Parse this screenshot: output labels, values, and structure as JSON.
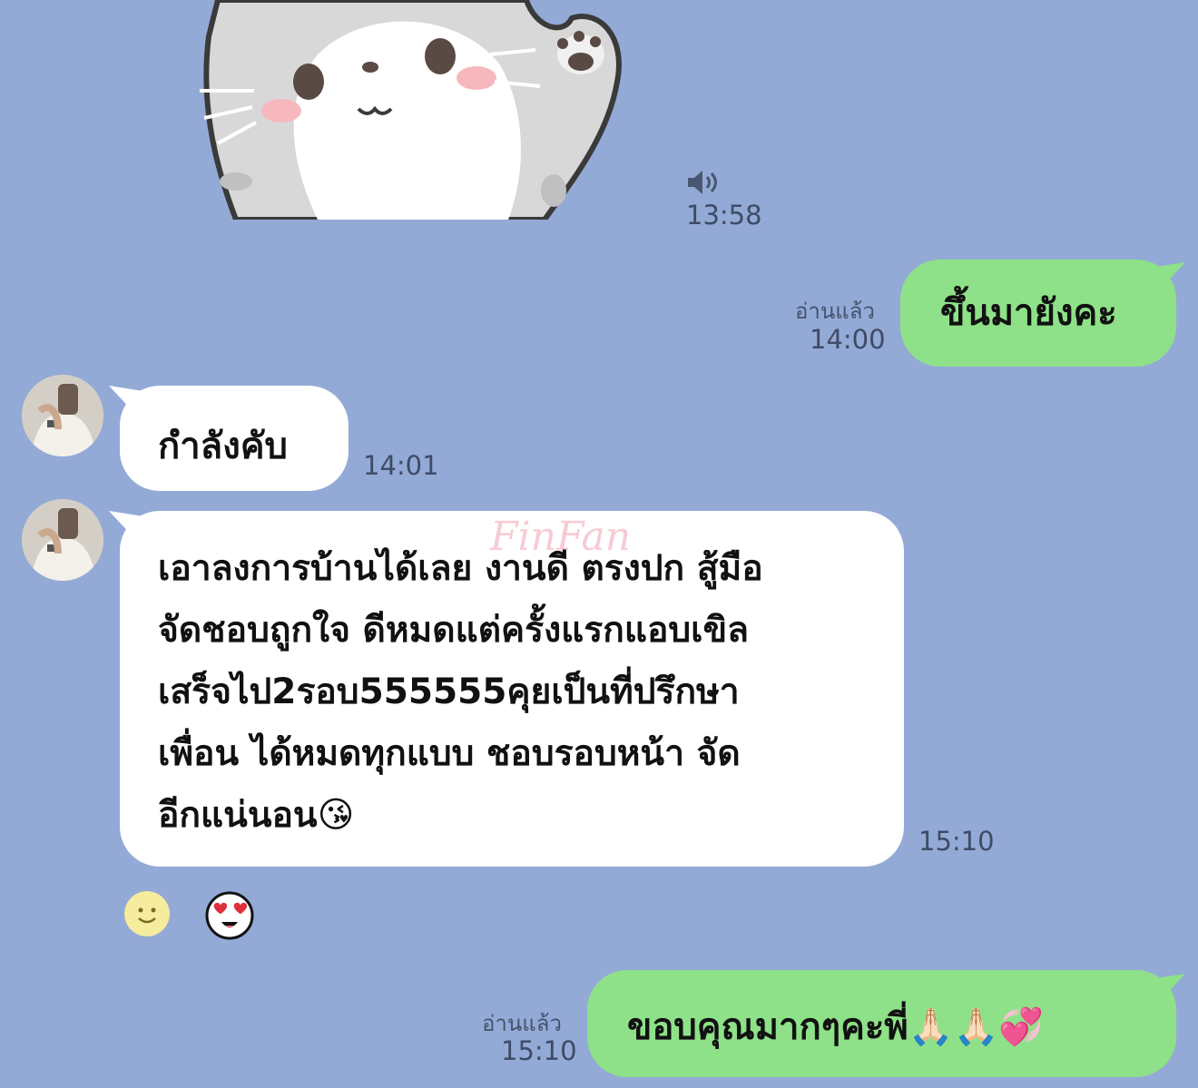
{
  "sticker": {
    "icon": "cat-waving-sticker-icon"
  },
  "messages": [
    {
      "time": "13:58"
    },
    {
      "read": "อ่านแล้ว",
      "time": "14:00",
      "text": "ขึ้นมายังคะ"
    },
    {
      "text": "กำลังคับ",
      "time": "14:01"
    },
    {
      "lines": [
        "เอาลงการบ้านได้เลย งานดี ตรงปก สู้มือ",
        "จัดชอบถูกใจ ดีหมดแต่ครั้งแรกแอบเขิล",
        "เสร็จไป2รอบ555555คุยเป็นที่ปรึกษา",
        "เพื่อน ได้หมดทุกแบบ ชอบรอบหน้า จัด",
        "อีกแน่นอน😘"
      ],
      "time": "15:10"
    },
    {
      "read": "อ่านแล้ว",
      "time": "15:10",
      "text": "ขอบคุณมากๆคะพี่🙏🏻🙏🏻💞"
    }
  ],
  "watermark": "FinFan",
  "colors": {
    "background": "#93aad6",
    "outgoing": "#8ee188",
    "incoming": "#ffffff"
  }
}
